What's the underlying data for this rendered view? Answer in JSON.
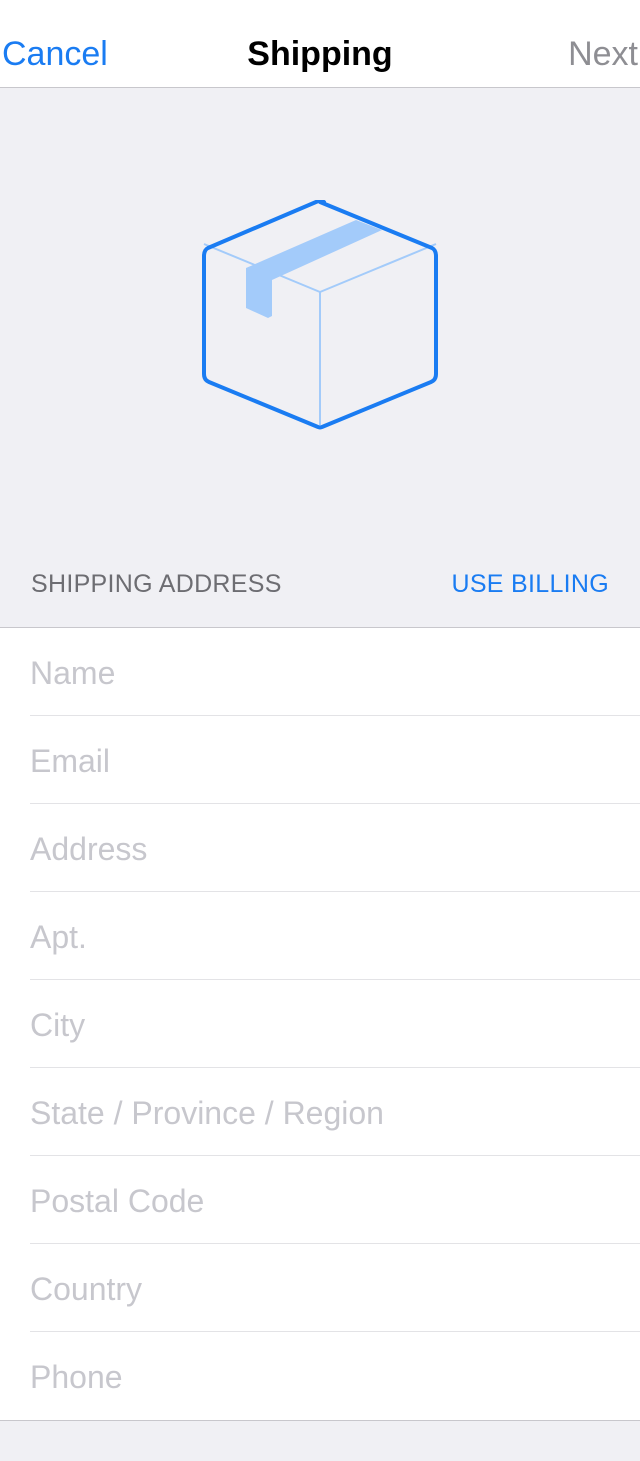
{
  "navbar": {
    "cancel_label": "Cancel",
    "title": "Shipping",
    "next_label": "Next"
  },
  "hero": {
    "icon": "package-box-icon"
  },
  "section": {
    "title": "SHIPPING ADDRESS",
    "action_label": "USE BILLING"
  },
  "fields": [
    {
      "placeholder": "Name",
      "value": ""
    },
    {
      "placeholder": "Email",
      "value": ""
    },
    {
      "placeholder": "Address",
      "value": ""
    },
    {
      "placeholder": "Apt.",
      "value": ""
    },
    {
      "placeholder": "City",
      "value": ""
    },
    {
      "placeholder": "State / Province / Region",
      "value": ""
    },
    {
      "placeholder": "Postal Code",
      "value": ""
    },
    {
      "placeholder": "Country",
      "value": ""
    },
    {
      "placeholder": "Phone",
      "value": ""
    }
  ],
  "colors": {
    "accent": "#1a7cf2",
    "background": "#f0f0f4",
    "placeholder": "#c7c7cd",
    "disabled": "#8e8e93"
  }
}
